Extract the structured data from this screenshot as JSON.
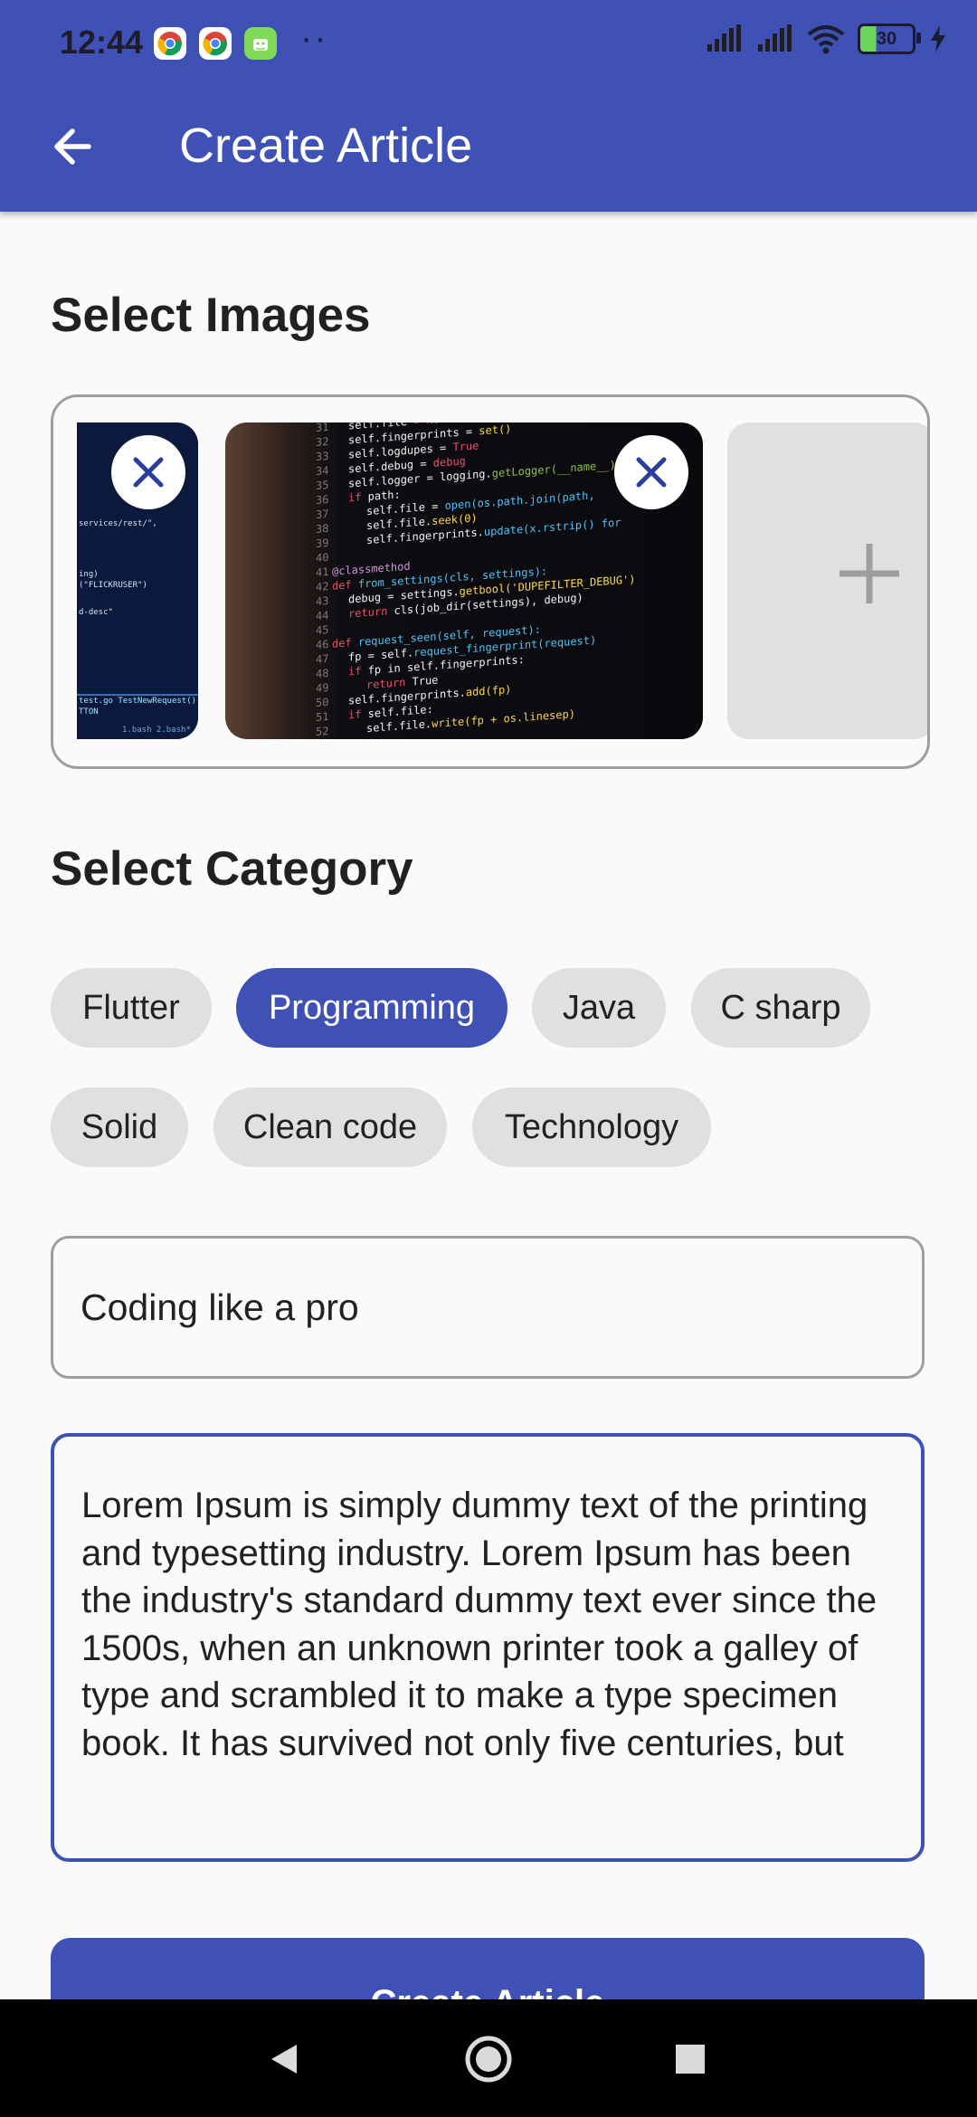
{
  "status_bar": {
    "time": "12:44",
    "battery_level": "30",
    "notification_icons": [
      "chrome-icon",
      "chrome-icon",
      "android-icon"
    ],
    "system_icons": [
      "signal-icon",
      "signal-icon",
      "wifi-icon",
      "battery-icon",
      "charging-icon"
    ]
  },
  "app_bar": {
    "title": "Create Article",
    "back_icon": "arrow-left-icon"
  },
  "images_section": {
    "title": "Select Images",
    "images": [
      {
        "name": "code-screenshot-1",
        "removable": true
      },
      {
        "name": "code-screenshot-2",
        "removable": true
      }
    ],
    "add_icon": "plus-icon"
  },
  "category_section": {
    "title": "Select Category",
    "chips": [
      {
        "label": "Flutter",
        "selected": false
      },
      {
        "label": "Programming",
        "selected": true
      },
      {
        "label": "Java",
        "selected": false
      },
      {
        "label": "C sharp",
        "selected": false
      },
      {
        "label": "Solid",
        "selected": false
      },
      {
        "label": "Clean code",
        "selected": false
      },
      {
        "label": "Technology",
        "selected": false
      }
    ]
  },
  "form": {
    "title_value": "Coding like a pro",
    "body_value": "Lorem Ipsum is simply dummy text of the printing and typesetting industry. Lorem Ipsum has been the industry's standard dummy text ever since the 1500s, when an unknown printer took a galley of type and scrambled it to make a type specimen book. It has survived not only five centuries, but"
  },
  "submit_button": {
    "label": "Create Article"
  },
  "colors": {
    "primary": "#3F51B5",
    "chip_bg": "#E0E0E0",
    "background": "#FAFAFA"
  },
  "nav_bar": {
    "icons": [
      "back-triangle-icon",
      "home-circle-icon",
      "recents-square-icon"
    ]
  }
}
